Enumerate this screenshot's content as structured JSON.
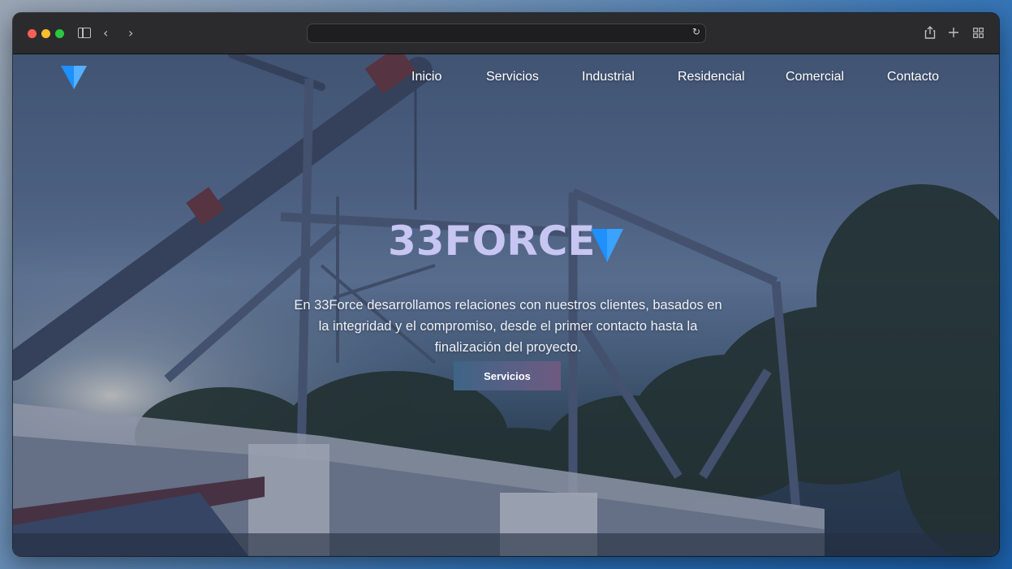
{
  "browser": {
    "url": "",
    "icons": [
      "sidebar-icon",
      "back-icon",
      "forward-icon",
      "reload-icon",
      "share-icon",
      "new-tab-icon",
      "tab-overview-icon"
    ]
  },
  "site": {
    "brand_color": "#1e90ff",
    "nav": [
      {
        "id": "inicio",
        "label": "Inicio"
      },
      {
        "id": "servicios",
        "label": "Servicios"
      },
      {
        "id": "industrial",
        "label": "Industrial"
      },
      {
        "id": "residencial",
        "label": "Residencial"
      },
      {
        "id": "comercial",
        "label": "Comercial"
      },
      {
        "id": "contacto",
        "label": "Contacto"
      }
    ],
    "hero": {
      "title": "33FORCE",
      "description": "En 33Force desarrollamos relaciones con nuestros clientes, basados en la integridad y el compromiso, desde el primer contacto hasta la finalización del proyecto.",
      "button_label": "Servicios"
    }
  }
}
